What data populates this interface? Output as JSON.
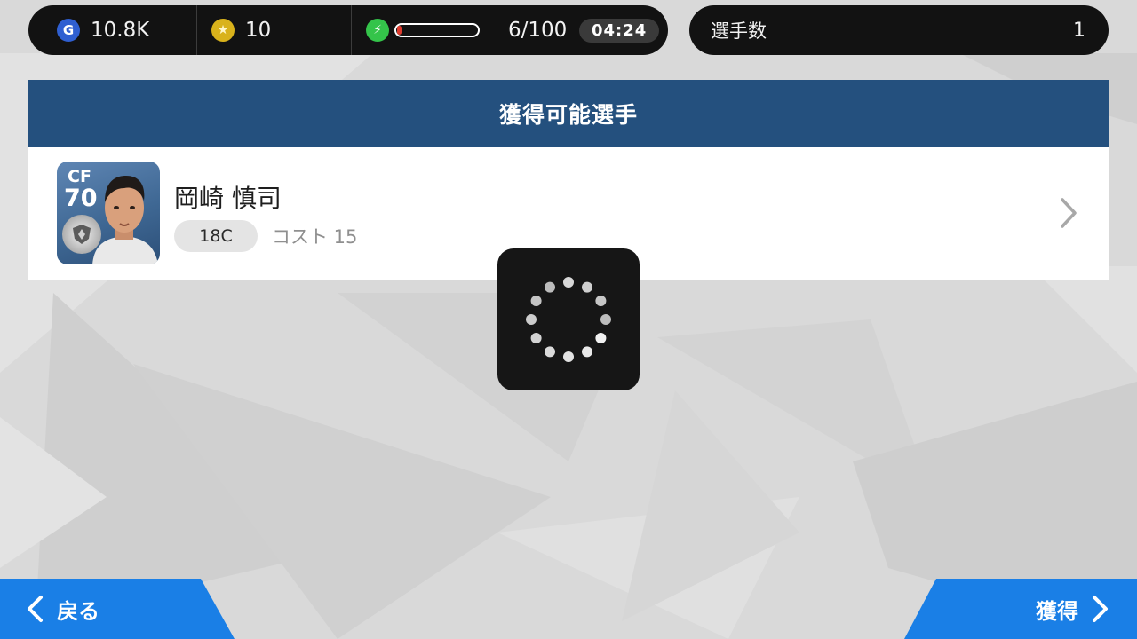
{
  "currency": {
    "gp_icon": "gp-coin-icon",
    "gp_value": "10.8K",
    "coin_icon": "star-coin-icon",
    "coin_value": "10"
  },
  "energy": {
    "icon": "lightning-icon",
    "fill_fraction": 0.06,
    "value": "6/100",
    "timer": "04:24"
  },
  "players_count": {
    "label": "選手数",
    "value": "1"
  },
  "section": {
    "title": "獲得可能選手"
  },
  "player": {
    "position": "CF",
    "rating": "70",
    "name": "岡崎 慎司",
    "pack": "18C",
    "cost_label": "コスト 15"
  },
  "footer": {
    "back_label": "戻る",
    "get_label": "獲得"
  },
  "colors": {
    "header_blue": "#24507e",
    "button_blue": "#1a7fe6",
    "bar_dark": "#121212"
  }
}
